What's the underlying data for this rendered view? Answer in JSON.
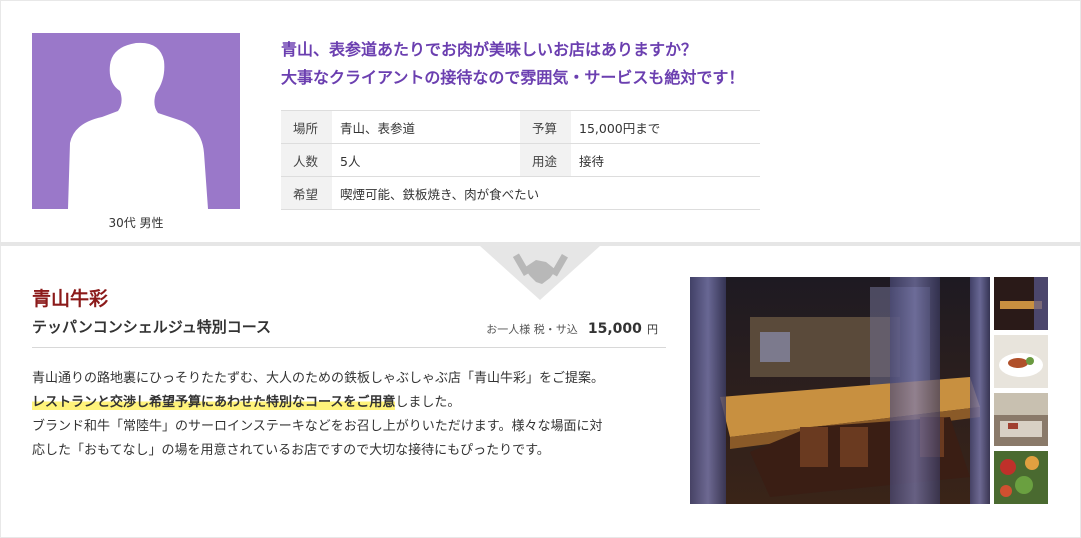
{
  "request": {
    "avatar_caption": "30代 男性",
    "question_line1": "青山、表参道あたりでお肉が美味しいお店はありますか？",
    "question_line2": "大事なクライアントの接待なので雰囲気・サービスも絶対です！",
    "rows": [
      {
        "label1": "場所",
        "value1": "青山、表参道",
        "label2": "予算",
        "value2": "15,000円まで"
      },
      {
        "label1": "人数",
        "value1": "5人",
        "label2": "用途",
        "value2": "接待"
      },
      {
        "label1": "希望",
        "value1": "喫煙可能、鉄板焼き、肉が食べたい"
      }
    ]
  },
  "proposal": {
    "shop_name": "青山牛彩",
    "course_name": "テッパンコンシェルジュ特別コース",
    "price_label": "お一人様 税・サ込",
    "price_value": "15,000",
    "price_unit": "円",
    "desc_line1": "青山通りの路地裏にひっそりたたずむ、大人のための鉄板しゃぶしゃぶ店「青山牛彩」をご提案。",
    "desc_highlight": "レストランと交渉し希望予算にあわせた特別なコースをご用意",
    "desc_line2_rest": "しました。",
    "desc_line3": "ブランド和牛「常陸牛」のサーロインステーキなどをお召し上がりいただけます。様々な場面に対",
    "desc_line4": "応した「おもてなし」の場を用意されているお店ですので大切な接待にもぴったりです。"
  },
  "colors": {
    "question": "#6b3fb0",
    "avatar_bg": "#9a78c9",
    "shop_name": "#8b1a1a",
    "highlight": "#fff37a"
  },
  "icons": {
    "avatar": "person-silhouette-icon",
    "handshake": "handshake-icon"
  }
}
